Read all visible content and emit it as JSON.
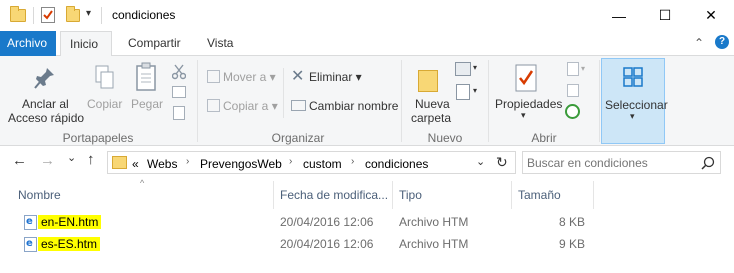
{
  "window": {
    "title": "condiciones",
    "minimize": "—",
    "maximize": "☐",
    "close": "✕"
  },
  "quick_access": {
    "dropdown": "▾"
  },
  "tabs": [
    {
      "label": "Archivo"
    },
    {
      "label": "Inicio"
    },
    {
      "label": "Compartir"
    },
    {
      "label": "Vista"
    }
  ],
  "ribbon": {
    "collapse": "⌃",
    "help": "?",
    "portapapeles": {
      "pin_line1": "Anclar al",
      "pin_line2": "Acceso rápido",
      "copy": "Copiar",
      "paste": "Pegar",
      "group": "Portapapeles"
    },
    "organizar": {
      "move": "Mover a ▾",
      "copy_to": "Copiar a ▾",
      "delete": "Eliminar ▾",
      "rename": "Cambiar nombre",
      "group": "Organizar"
    },
    "nuevo": {
      "folder_line1": "Nueva",
      "folder_line2": "carpeta",
      "group": "Nuevo"
    },
    "abrir": {
      "properties": "Propiedades",
      "arrow": "▾",
      "group": "Abrir"
    },
    "seleccionar": {
      "label": "Seleccionar",
      "arrow": "▾"
    }
  },
  "nav": {
    "back": "←",
    "forward": "→",
    "recent": "⌄",
    "up": "↑"
  },
  "address": {
    "overflow": "«",
    "crumbs": [
      "Webs",
      "PrevengosWeb",
      "custom",
      "condiciones"
    ],
    "sep": "›",
    "dropdown": "⌄",
    "refresh": "↻"
  },
  "search": {
    "placeholder": "Buscar en condiciones"
  },
  "columns": {
    "name": "Nombre",
    "date": "Fecha de modifica...",
    "type": "Tipo",
    "size": "Tamaño",
    "sort": "^"
  },
  "files": [
    {
      "name": "en-EN.htm",
      "date": "20/04/2016 12:06",
      "type": "Archivo HTM",
      "size": "8 KB"
    },
    {
      "name": "es-ES.htm",
      "date": "20/04/2016 12:06",
      "type": "Archivo HTM",
      "size": "9 KB"
    }
  ],
  "colors": {
    "file_tab": "#1979ca",
    "highlight": "#ffff00",
    "folder": "#f8d775",
    "column_header_text": "#4c607a"
  }
}
